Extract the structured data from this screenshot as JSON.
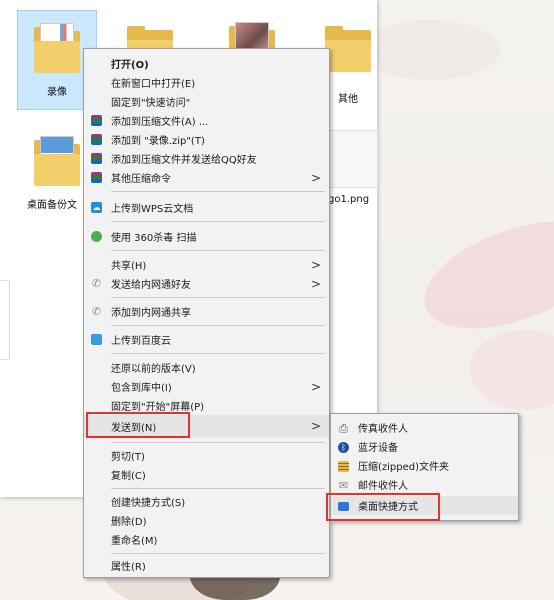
{
  "explorer": {
    "files": [
      {
        "label": "录像",
        "selected": true
      },
      {
        "label": "",
        "selected": false
      },
      {
        "label": "",
        "selected": false
      },
      {
        "label": "其他",
        "selected": false
      },
      {
        "label": "桌面备份文",
        "selected": false
      },
      {
        "label": "go1.png",
        "selected": false
      }
    ]
  },
  "menu": {
    "items": [
      {
        "label": "打开(O)",
        "icon": "none",
        "bold": true
      },
      {
        "label": "在新窗口中打开(E)",
        "icon": "none"
      },
      {
        "label": "固定到\"快速访问\"",
        "icon": "none"
      },
      {
        "label": "添加到压缩文件(A) ...",
        "icon": "winrar-icon"
      },
      {
        "label": "添加到 \"录像.zip\"(T)",
        "icon": "winrar-icon"
      },
      {
        "label": "添加到压缩文件并发送给QQ好友",
        "icon": "winrar-icon"
      },
      {
        "label": "其他压缩命令",
        "icon": "winrar-icon",
        "submenu": true
      },
      {
        "label": "上传到WPS云文档",
        "icon": "wps-cloud-icon"
      },
      {
        "label": "使用 360杀毒 扫描",
        "icon": "shield-360-icon"
      },
      {
        "label": "共享(H)",
        "icon": "none",
        "submenu": true
      },
      {
        "label": "发送给内网通好友",
        "icon": "intranet-icon",
        "submenu": true
      },
      {
        "label": "添加到内网通共享",
        "icon": "intranet-icon"
      },
      {
        "label": "上传到百度云",
        "icon": "baidu-cloud-icon"
      },
      {
        "label": "还原以前的版本(V)",
        "icon": "none"
      },
      {
        "label": "包含到库中(I)",
        "icon": "none",
        "submenu": true
      },
      {
        "label": "固定到\"开始\"屏幕(P)",
        "icon": "none"
      },
      {
        "label": "发送到(N)",
        "icon": "none",
        "submenu": true,
        "highlighted": true
      },
      {
        "label": "剪切(T)",
        "icon": "none"
      },
      {
        "label": "复制(C)",
        "icon": "none"
      },
      {
        "label": "创建快捷方式(S)",
        "icon": "none"
      },
      {
        "label": "删除(D)",
        "icon": "none"
      },
      {
        "label": "重命名(M)",
        "icon": "none"
      },
      {
        "label": "属性(R)",
        "icon": "none"
      }
    ],
    "submenu_arrow": ">"
  },
  "sendto": {
    "items": [
      {
        "label": "传真收件人",
        "icon": "fax-icon"
      },
      {
        "label": "蓝牙设备",
        "icon": "bluetooth-icon"
      },
      {
        "label": "压缩(zipped)文件夹",
        "icon": "zip-folder-icon"
      },
      {
        "label": "邮件收件人",
        "icon": "mail-icon"
      },
      {
        "label": "桌面快捷方式",
        "icon": "desktop-icon",
        "highlighted": true
      }
    ]
  },
  "colors": {
    "highlight_box": "#e8312b",
    "selection": "#cce8ff",
    "menu_bg": "#f2f2f2"
  }
}
